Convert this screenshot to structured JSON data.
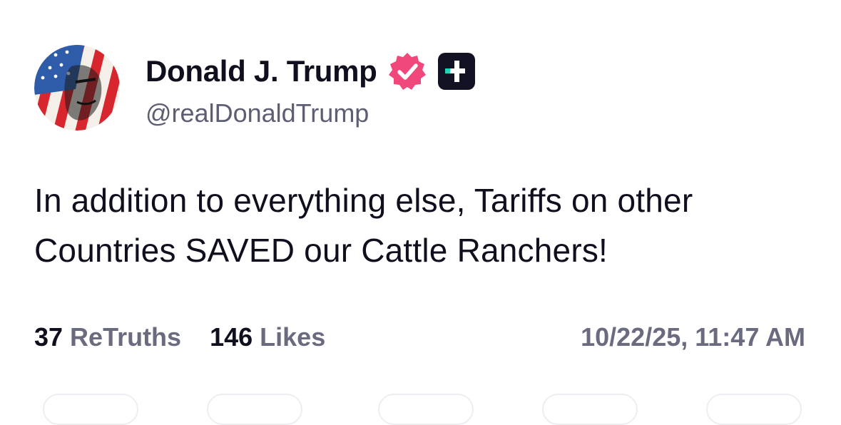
{
  "post": {
    "author": {
      "display_name": "Donald J. Trump",
      "handle": "@realDonaldTrump",
      "avatar_icon": "flag-portrait-avatar",
      "verified_icon": "verified-badge-icon",
      "verified_color": "#f0487b",
      "membership_icon": "plus-badge-icon",
      "membership_color": "#1ed6b5"
    },
    "body": "In addition to everything else, Tariffs on other Countries SAVED our Cattle Ranchers!",
    "stats": {
      "retruths_count": "37",
      "retruths_label": "ReTruths",
      "likes_count": "146",
      "likes_label": "Likes"
    },
    "timestamp": "10/22/25, 11:47 AM"
  }
}
